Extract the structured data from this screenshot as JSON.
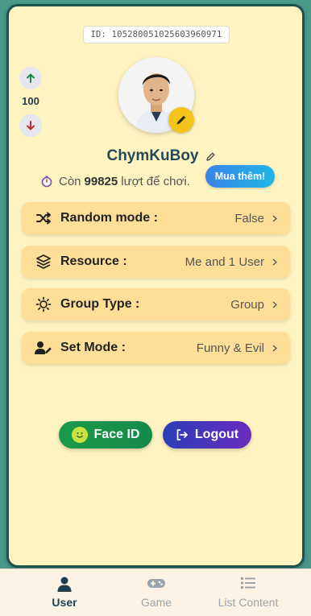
{
  "user_id": "ID: 105280051025603960971",
  "vote": {
    "count": "100"
  },
  "profile": {
    "username": "ChymKuBoy",
    "plays_prefix": "Còn",
    "plays_count": "99825",
    "plays_suffix": "lượt để chơi.",
    "buy_more_label": "Mua thêm!"
  },
  "settings": [
    {
      "label": "Random mode :",
      "value": "False",
      "icon": "shuffle-icon"
    },
    {
      "label": "Resource :",
      "value": "Me and 1 User",
      "icon": "layers-icon"
    },
    {
      "label": "Group Type :",
      "value": "Group",
      "icon": "sun-icon"
    },
    {
      "label": "Set Mode :",
      "value": "Funny & Evil",
      "icon": "user-edit-icon"
    }
  ],
  "actions": {
    "face_id_label": "Face ID",
    "logout_label": "Logout"
  },
  "tabs": [
    {
      "label": "User",
      "icon": "user-icon",
      "active": true
    },
    {
      "label": "Game",
      "icon": "gamepad-icon",
      "active": false
    },
    {
      "label": "List Content",
      "icon": "list-icon",
      "active": false
    }
  ],
  "colors": {
    "card_bg": "#fff3c1",
    "setting_bg": "#ffdf97",
    "accent_green": "#1b9a4a",
    "accent_purple": "#4a35bb",
    "edit_yellow": "#f5c41a"
  }
}
